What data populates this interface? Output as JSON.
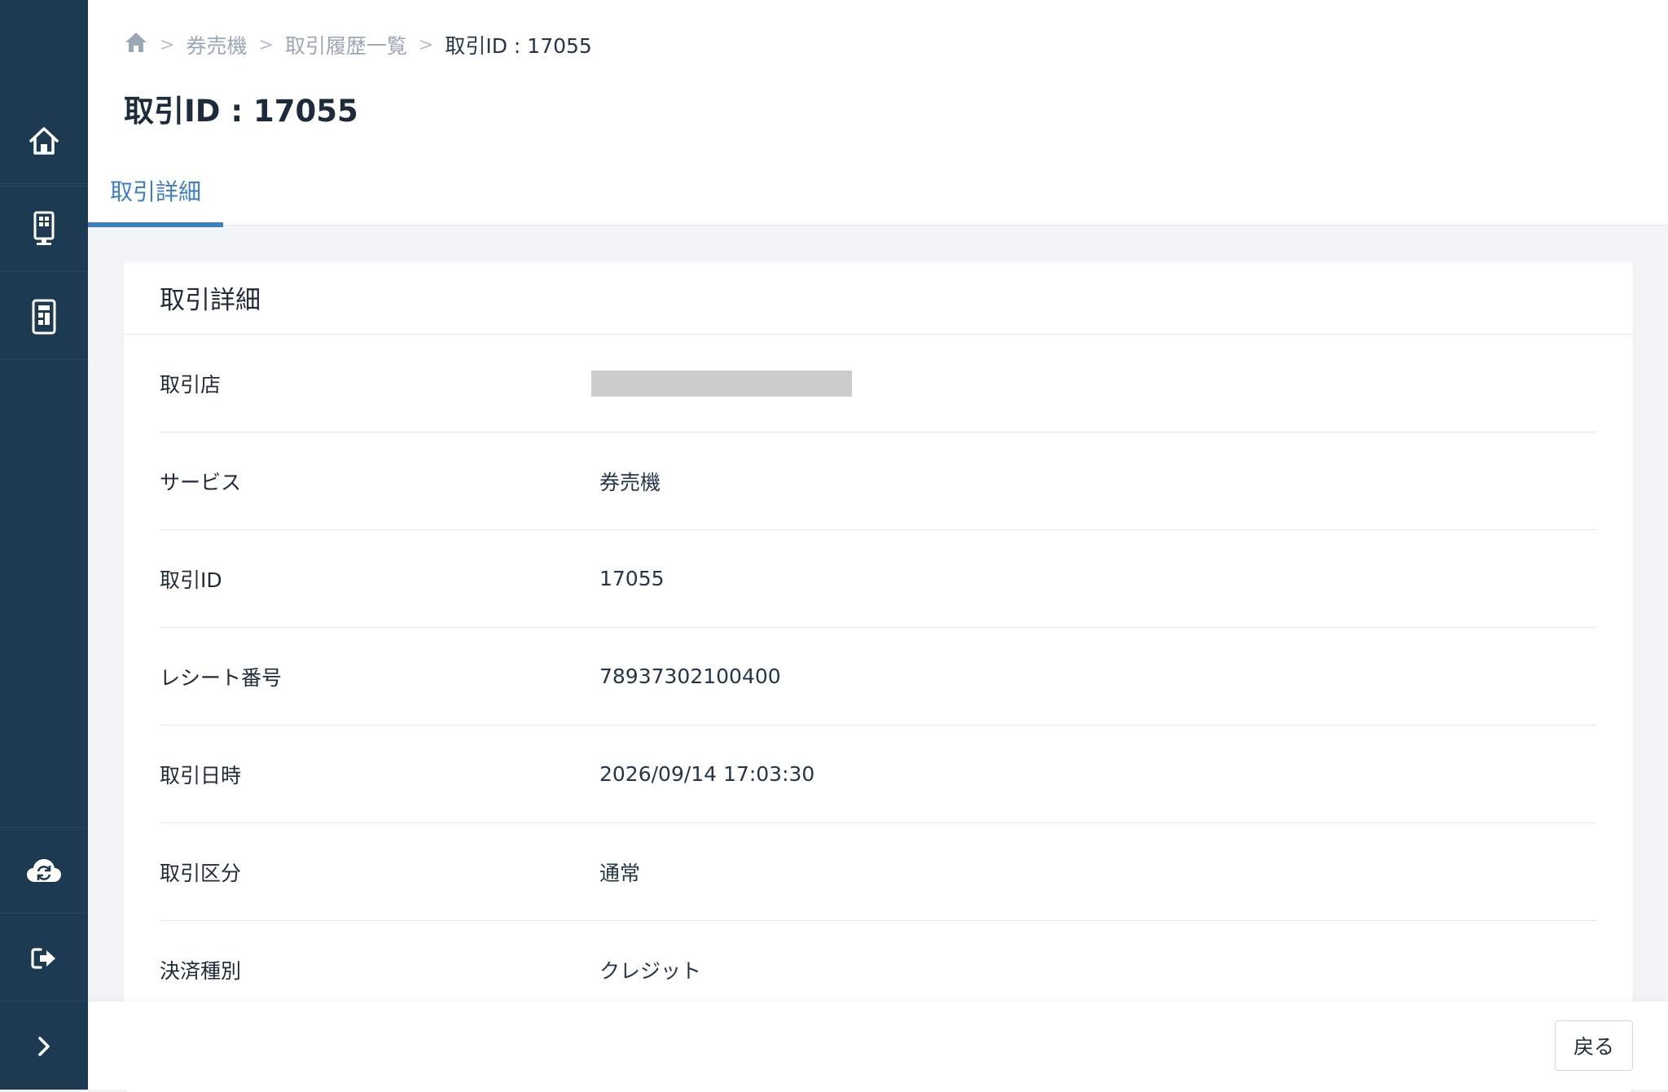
{
  "breadcrumb": {
    "items": [
      "券売機",
      "取引履歴一覧"
    ],
    "current": "取引ID : 17055"
  },
  "page": {
    "title": "取引ID : 17055"
  },
  "tabs": [
    {
      "label": "取引詳細",
      "active": true
    }
  ],
  "card": {
    "title": "取引詳細",
    "rows": [
      {
        "label": "取引店",
        "value": ""
      },
      {
        "label": "サービス",
        "value": "券売機"
      },
      {
        "label": "取引ID",
        "value": "17055"
      },
      {
        "label": "レシート番号",
        "value": "78937302100400"
      },
      {
        "label": "取引日時",
        "value": "2026/09/14 17:03:30"
      },
      {
        "label": "取引区分",
        "value": "通常"
      },
      {
        "label": "決済種別",
        "value": "クレジット"
      }
    ]
  },
  "footer": {
    "back_label": "戻る"
  },
  "sidebar": {
    "icons": [
      "home-icon",
      "kiosk-icon",
      "device-icon",
      "cloud-sync-icon",
      "logout-icon",
      "chevron-right-icon"
    ]
  },
  "colors": {
    "sidebar_bg": "#1c3a52",
    "accent": "#3d7ec9",
    "redacted": "#cccccc"
  }
}
